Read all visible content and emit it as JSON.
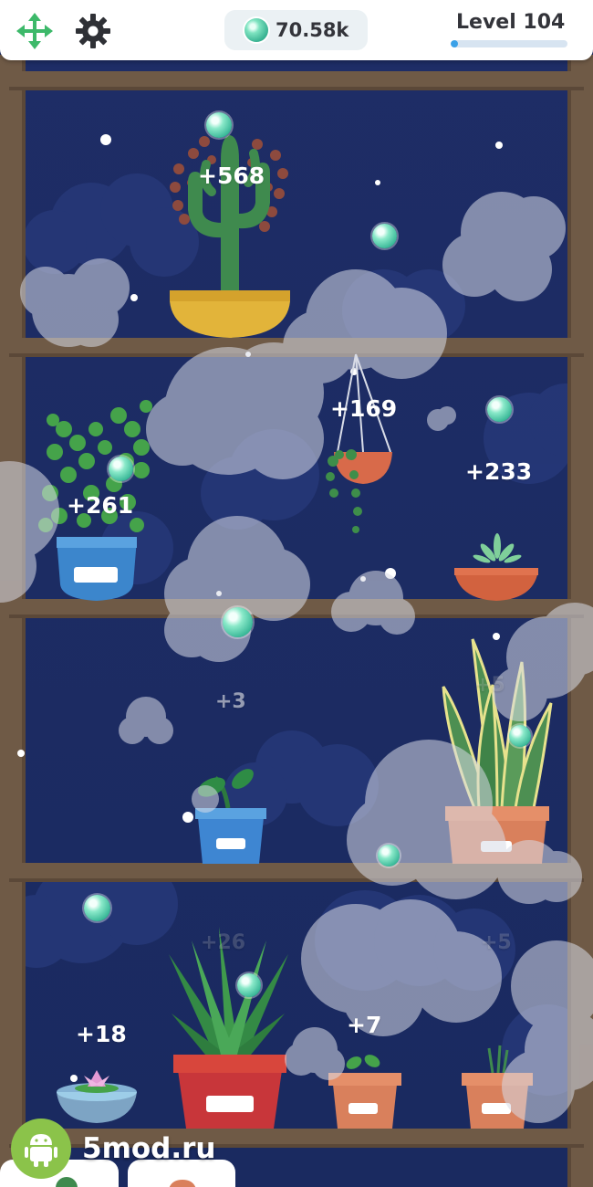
{
  "header": {
    "currency_amount": "70.58k",
    "level_label": "Level 104",
    "level_progress": 0.06
  },
  "rewards": {
    "cactus": "+568",
    "hanging_plant": "+169",
    "fern": "+261",
    "succulent": "+233",
    "sprout_pot": "+3",
    "snake_plant": "+5",
    "aloe": "+26",
    "right_bottom": "+5",
    "water_lily": "+18",
    "small_pot": "+7"
  },
  "watermark": {
    "site": "5mod.ru"
  },
  "colors": {
    "night_sky": "#1c2b62",
    "shelf_wood": "#6f5a46",
    "gem": "#4fcba8",
    "level_bar": "#3aa1e8"
  }
}
